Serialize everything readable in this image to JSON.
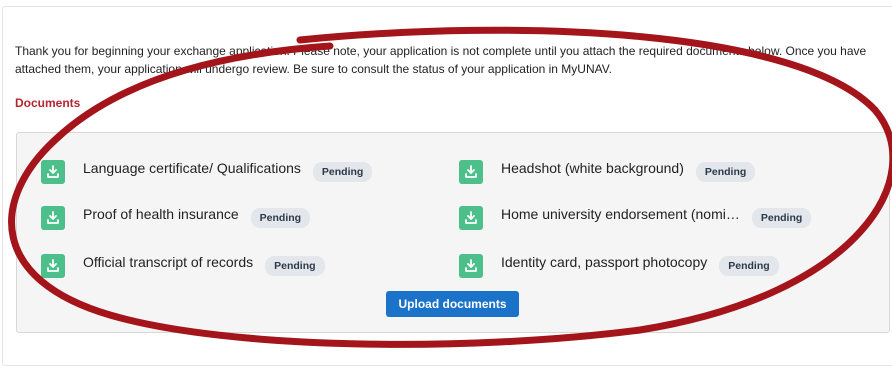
{
  "intro": {
    "text": "Thank you for beginning your exchange application. Please note, your application is not complete until you attach the required documents below. Once you have attached them, your application will undergo review. Be sure to consult the status of your application in MyUNAV."
  },
  "documents": {
    "section_title": "Documents",
    "items": [
      {
        "label": "Language certificate/ Qualifications",
        "status": "Pending"
      },
      {
        "label": "Headshot (white background)",
        "status": "Pending"
      },
      {
        "label": "Proof of health insurance",
        "status": "Pending"
      },
      {
        "label": "Home university endorsement (nomi…",
        "status": "Pending"
      },
      {
        "label": "Official transcript of records",
        "status": "Pending"
      },
      {
        "label": "Identity card, passport photocopy",
        "status": "Pending"
      }
    ],
    "upload_label": "Upload documents",
    "icon": "download-icon"
  },
  "colors": {
    "accent": "#1a73c9",
    "section_title": "#b5262f",
    "icon_bg": "#4cbf8a",
    "annotation": "#a3141b"
  }
}
